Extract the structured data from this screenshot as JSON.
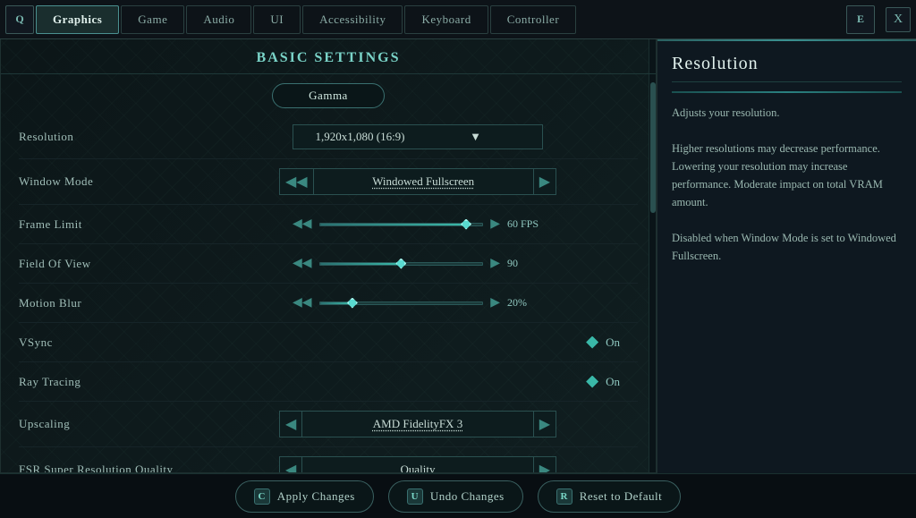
{
  "nav": {
    "left_icon": "Q",
    "right_icon": "E",
    "close_icon": "X",
    "tabs": [
      {
        "label": "Graphics",
        "active": true
      },
      {
        "label": "Game",
        "active": false
      },
      {
        "label": "Audio",
        "active": false
      },
      {
        "label": "UI",
        "active": false
      },
      {
        "label": "Accessibility",
        "active": false
      },
      {
        "label": "Keyboard",
        "active": false
      },
      {
        "label": "Controller",
        "active": false
      }
    ]
  },
  "panel": {
    "title": "Basic Settings",
    "gamma_label": "Gamma",
    "settings": [
      {
        "label": "Resolution",
        "type": "dropdown",
        "value": "1,920x1,080 (16:9)"
      },
      {
        "label": "Window Mode",
        "type": "arrow",
        "value": "Windowed Fullscreen"
      },
      {
        "label": "Frame Limit",
        "type": "slider",
        "value": "60 FPS",
        "fill_pct": 90
      },
      {
        "label": "Field Of View",
        "type": "slider",
        "value": "90",
        "fill_pct": 50
      },
      {
        "label": "Motion Blur",
        "type": "slider",
        "value": "20%",
        "fill_pct": 20
      },
      {
        "label": "VSync",
        "type": "toggle",
        "value": "On"
      },
      {
        "label": "Ray Tracing",
        "type": "toggle",
        "value": "On"
      },
      {
        "label": "Upscaling",
        "type": "arrow",
        "value": "AMD FidelityFX 3"
      },
      {
        "label": "FSR Super Resolution Quality",
        "type": "arrow",
        "value": "Quality"
      }
    ]
  },
  "info": {
    "title": "Resolution",
    "divider": true,
    "text": "Adjusts your resolution.\n\nHigher resolutions may decrease performance. Lowering your resolution may increase performance.\nModerate impact on total VRAM amount.\n\nDisabled when Window Mode is set to Windowed Fullscreen."
  },
  "bottom": {
    "apply_key": "C",
    "apply_label": "Apply Changes",
    "undo_key": "U",
    "undo_label": "Undo Changes",
    "reset_key": "R",
    "reset_label": "Reset to Default"
  }
}
